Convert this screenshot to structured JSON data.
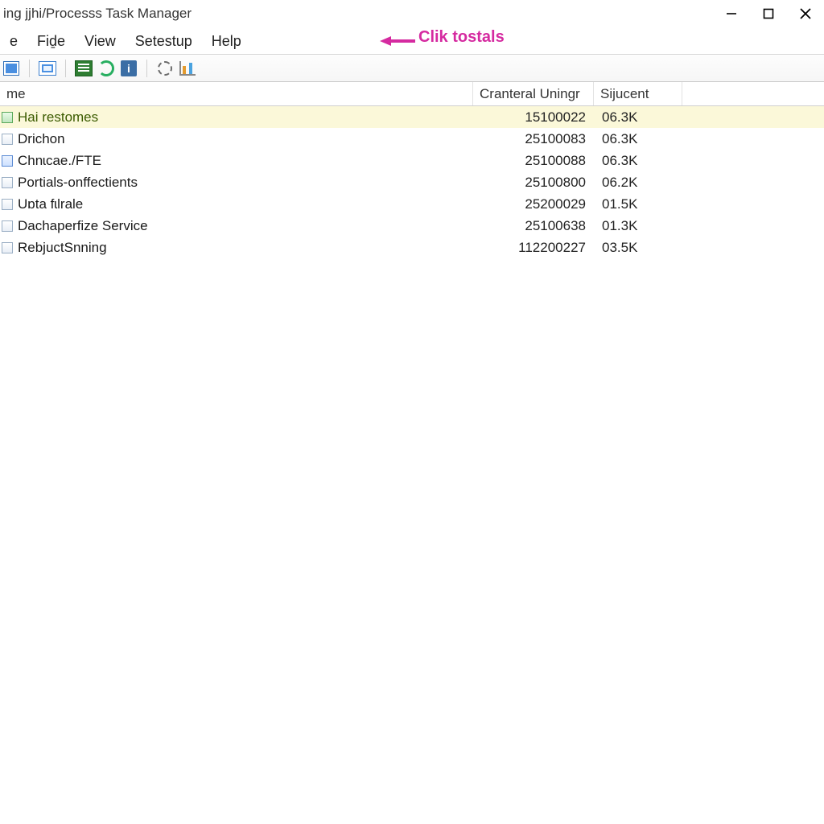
{
  "window": {
    "title": "ing jjhi/Processs Task Manager"
  },
  "menus": {
    "m0": "e",
    "file": "Fiḏe",
    "view": "View",
    "setup": "Setestup",
    "help": "Help"
  },
  "annotation": {
    "text": "Clik tostals"
  },
  "columns": {
    "name": "me",
    "b": "Cranteral Uningr",
    "c": "Sijucent"
  },
  "rows": [
    {
      "name": "Hai restomes",
      "b": "15100022",
      "c": "06.3K",
      "icon": "green",
      "selected": true
    },
    {
      "name": "Drichon",
      "b": "25100083",
      "c": "06.3K",
      "icon": "plain"
    },
    {
      "name": "Chnɩcae./FTE",
      "b": "25100088",
      "c": "06.3K",
      "icon": "blue"
    },
    {
      "name": "Portials-onffectients",
      "b": "25100800",
      "c": "06.2K",
      "icon": "plain"
    },
    {
      "name": "Uɒta fɩlrale",
      "b": "25200029",
      "c": "01.5K",
      "icon": "plain"
    },
    {
      "name": "Dachaperfize Service",
      "b": "25100638",
      "c": "01.3K",
      "icon": "plain"
    },
    {
      "name": "RebjuctSnning",
      "b": "112200227",
      "c": "03.5K",
      "icon": "plain"
    }
  ]
}
